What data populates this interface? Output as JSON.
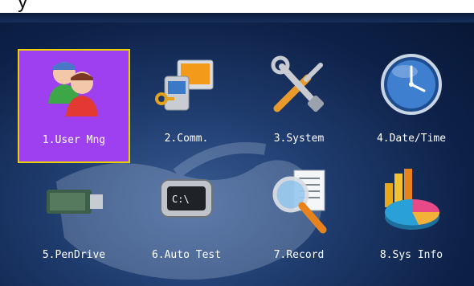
{
  "caption": "y",
  "menu": {
    "items": [
      {
        "label": "1.User Mng",
        "icon": "users-icon",
        "selected": true
      },
      {
        "label": "2.Comm.",
        "icon": "communication-icon",
        "selected": false
      },
      {
        "label": "3.System",
        "icon": "tools-icon",
        "selected": false
      },
      {
        "label": "4.Date/Time",
        "icon": "clock-icon",
        "selected": false
      },
      {
        "label": "5.PenDrive",
        "icon": "usb-drive-icon",
        "selected": false
      },
      {
        "label": "6.Auto Test",
        "icon": "auto-test-icon",
        "selected": false
      },
      {
        "label": "7.Record",
        "icon": "magnifier-record-icon",
        "selected": false
      },
      {
        "label": "8.Sys Info",
        "icon": "pie-chart-icon",
        "selected": false
      }
    ]
  },
  "colors": {
    "selected_bg": "#9e3ff0",
    "selected_border": "#e8d200",
    "background": "#0d2148"
  }
}
